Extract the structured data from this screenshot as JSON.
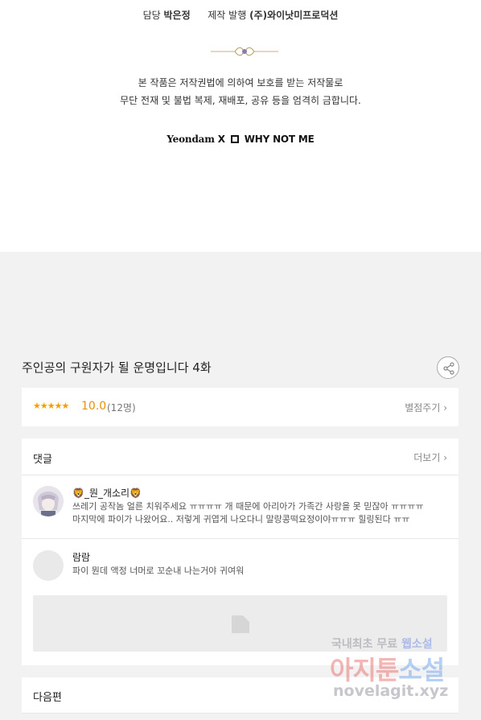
{
  "credits": {
    "manager_label": "담당",
    "manager_name": "박은정",
    "production_label": "제작 발행",
    "production_company": "(주)와이낫미프로덕션",
    "copyright_line1": "본 작품은 저작권법에 의하여 보호를 받는 저작물로",
    "copyright_line2": "무단 전재 및 불법 복제, 재배포, 공유 등을 엄격히 금합니다.",
    "logo_left": "Yeondam",
    "logo_separator": "X",
    "logo_right": "WHY NOT ME"
  },
  "episode": {
    "title": "주인공의 구원자가 될 운명입니다 4화",
    "share_icon": "share-icon"
  },
  "rating": {
    "stars": "★★★★★",
    "score": "10.0",
    "count": "(12명)",
    "rate_link": "별점주기 ›"
  },
  "comments": {
    "title": "댓글",
    "more_link": "더보기 ›",
    "items": [
      {
        "nickname": "🦁_뭔_개소리🦁",
        "text_line1": "쓰레기 공작놈 얼른 치워주세요 ㅠㅠㅠㅠ 개 때문에 아리아가 가족간 사랑을 못 믿잖아 ㅠㅠㅠㅠ",
        "text_line2": "마지막에 파이가 나왔어요.. 저렇게 귀엽게 나오다니 말랑콩떡요정이야ㅠㅠㅠ 힐링된다 ㅠㅠ"
      },
      {
        "nickname": "람람",
        "text_line1": "파이 뭔데 액정 너머로 꼬순내 나는거야 귀여워"
      }
    ]
  },
  "next": {
    "title": "다음편"
  },
  "watermark": {
    "line1_a": "국내최초 무료",
    "line1_b": "웹소설",
    "line2_a": "아지툰",
    "line2_b": "소설",
    "line3": "novelagit.xyz"
  },
  "colors": {
    "star": "#f0a000",
    "score": "#e8900a",
    "background": "#f2f2f2"
  }
}
